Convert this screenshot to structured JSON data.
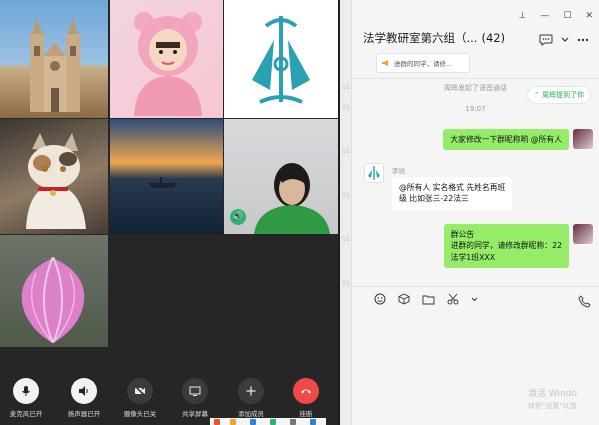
{
  "call": {
    "participant_badge": "🔊",
    "controls": [
      {
        "id": "mic",
        "label": "麦克风已开",
        "icon": "microphone-icon"
      },
      {
        "id": "speaker",
        "label": "扬声器已开",
        "icon": "speaker-icon"
      },
      {
        "id": "camera",
        "label": "摄像头已关",
        "icon": "camera-off-icon"
      },
      {
        "id": "share",
        "label": "共享屏幕",
        "icon": "screen-share-icon"
      },
      {
        "id": "add",
        "label": "添加成员",
        "icon": "plus-icon"
      },
      {
        "id": "hangup",
        "label": "挂断",
        "icon": "hang-up-icon"
      }
    ]
  },
  "chat": {
    "title": "法学教研室第六组（...",
    "member_count": "(42)",
    "notice_chip": "进群的同学，请修...",
    "system_msg": "周辉发起了语音通话",
    "time": "19:07",
    "mention_pill": "周辉提到了你",
    "messages": [
      {
        "side": "right",
        "text": "大家修改一下群昵称哟 @所有人"
      },
      {
        "side": "left",
        "sender": "李锐",
        "text_line1": "@所有人 实名格式   先姓名再班",
        "text_line2": "级   比如张三-22法三"
      },
      {
        "side": "right",
        "text_line1": "群公告",
        "text_line2": "进群的同学，请修改群昵称：22",
        "text_line3": "法学1班XXX"
      }
    ],
    "toolbar_icons": [
      "emoji-icon",
      "cube-icon",
      "folder-icon",
      "scissors-icon",
      "chevron-down-icon"
    ],
    "call_icon": "phone-icon",
    "watermark_line1": "激活 Windo",
    "watermark_line2": "转到\"设置\"以激"
  },
  "colors": {
    "bubble_green": "#95ec69",
    "accent_green": "#20a85a",
    "hangup_red": "#ef4a47"
  }
}
